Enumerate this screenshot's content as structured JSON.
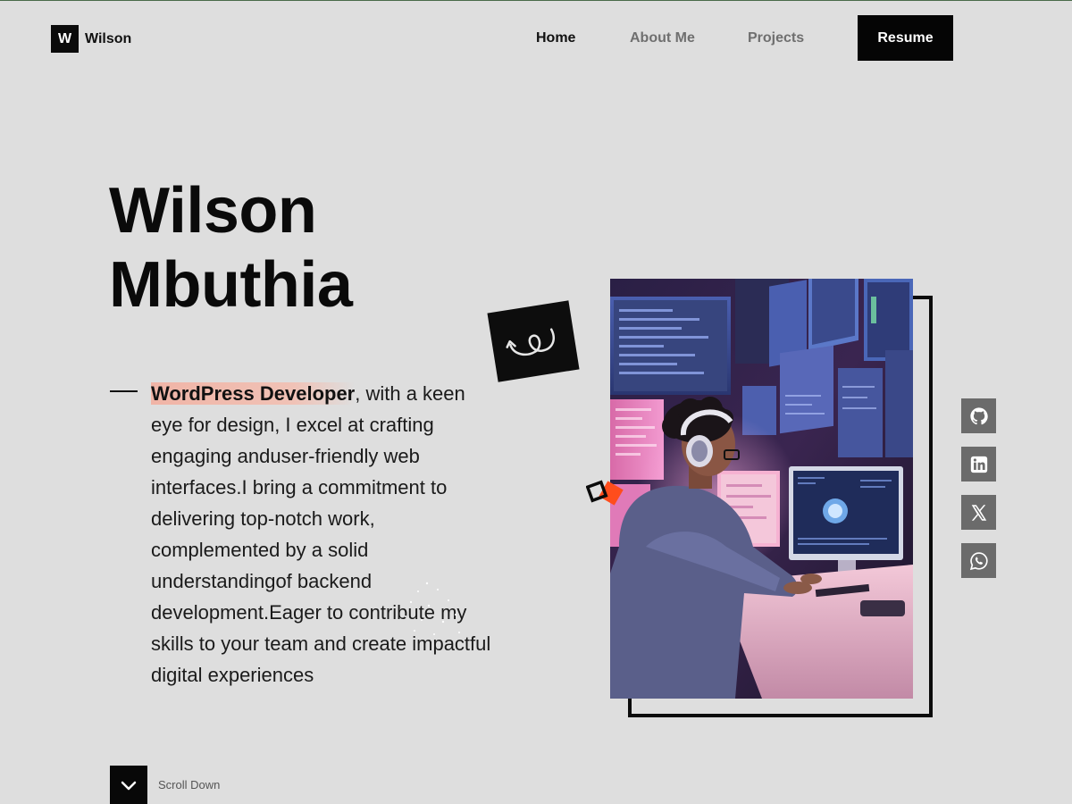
{
  "header": {
    "logo_letter": "W",
    "logo_name": "Wilson",
    "nav": {
      "home": "Home",
      "about": "About Me",
      "projects": "Projects"
    },
    "resume_label": "Resume"
  },
  "hero": {
    "name_line1": "Wilson",
    "name_line2": "Mbuthia",
    "role_highlight": "WordPress Developer",
    "bio_rest": ", with a keen eye for design, I excel at crafting engaging anduser-friendly web interfaces.I bring a commitment to delivering top-notch work, complemented by a solid understandingof backend development.Eager to contribute my skills to your team and create impactful digital experiences"
  },
  "scroll": {
    "label": "Scroll Down",
    "icon": "chevron-down-icon"
  },
  "social_links": [
    {
      "icon": "github-icon"
    },
    {
      "icon": "linkedin-icon"
    },
    {
      "icon": "x-twitter-icon"
    },
    {
      "icon": "whatsapp-icon"
    }
  ],
  "colors": {
    "background": "#dedede",
    "dark": "#0b0b0b",
    "accent_orange": "#ff4d1c",
    "highlight": "#f0b4a6",
    "social_bg": "#6b6b6b"
  }
}
